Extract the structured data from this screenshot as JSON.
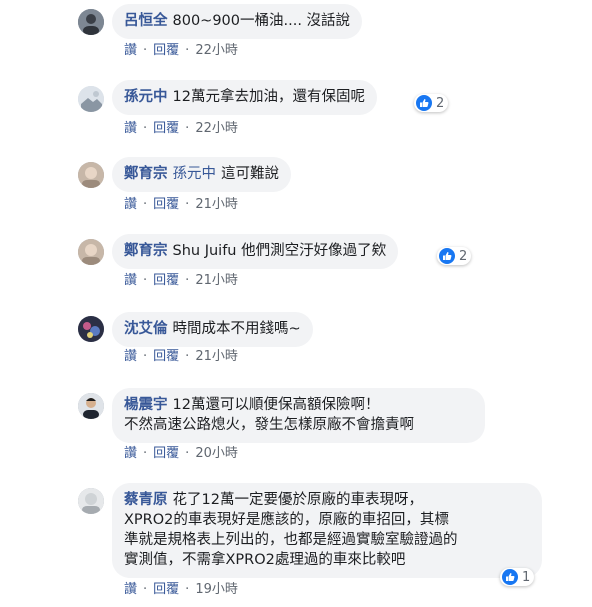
{
  "actions": {
    "like": "讚",
    "reply": "回覆",
    "dot": "·"
  },
  "comments": [
    {
      "author": "呂恒全",
      "mention": "",
      "text": "800~900一桶油.... 沒話說",
      "time": "22小時",
      "likes": ""
    },
    {
      "author": "孫元中",
      "mention": "",
      "text": "12萬元拿去加油，還有保固呢",
      "time": "22小時",
      "likes": "2"
    },
    {
      "author": "鄭育宗",
      "mention": "孫元中",
      "text": "這可難說",
      "time": "21小時",
      "likes": ""
    },
    {
      "author": "鄭育宗",
      "mention": "",
      "text": "Shu Juifu 他們測空汙好像過了欸",
      "time": "21小時",
      "likes": "2"
    },
    {
      "author": "沈艾倫",
      "mention": "",
      "text": "時間成本不用錢嗎~",
      "time": "21小時",
      "likes": ""
    },
    {
      "author": "楊震宇",
      "mention": "",
      "lines": [
        "12萬還可以順便保高額保險啊！",
        "不然高速公路熄火，發生怎樣原廠不會擔責啊"
      ],
      "time": "20小時",
      "likes": ""
    },
    {
      "author": "蔡青原",
      "mention": "",
      "lines": [
        "花了12萬一定要優於原廠的車表現呀，",
        "XPRO2的車表現好是應該的，原廠的車招回，其標",
        "準就是規格表上列出的，也都是經過實驗室驗證過的",
        "實測值，不需拿XPRO2處理過的車來比較吧"
      ],
      "time": "19小時",
      "likes": "1"
    }
  ],
  "colors": {
    "link": "#385898",
    "bubble": "#f2f3f5",
    "meta": "#606770",
    "like_blue": "#1877f2"
  }
}
